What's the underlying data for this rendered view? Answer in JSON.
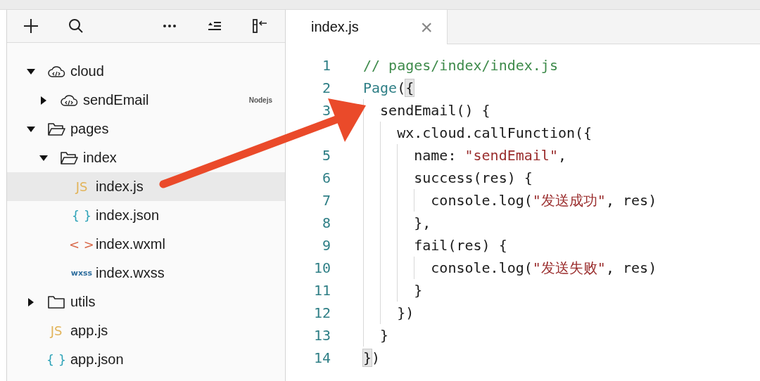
{
  "toolbar": {
    "buttons": [
      {
        "kind": "add"
      },
      {
        "kind": "search"
      },
      {
        "kind": "more"
      },
      {
        "kind": "collapse"
      },
      {
        "kind": "dock"
      }
    ]
  },
  "tree": [
    {
      "label": "cloud",
      "kind": "cloud",
      "expanded": true,
      "selected": false,
      "children": [
        {
          "label": "sendEmail",
          "kind": "cloud",
          "expanded": false,
          "selected": false,
          "tag": "Nodejs"
        }
      ]
    },
    {
      "label": "pages",
      "kind": "folder",
      "expanded": true,
      "selected": false,
      "children": [
        {
          "label": "index",
          "kind": "folder",
          "expanded": true,
          "selected": false,
          "children": [
            {
              "label": "index.js",
              "kind": "file",
              "badge": "JS",
              "color": "#e2b45a",
              "selected": true
            },
            {
              "label": "index.json",
              "kind": "file",
              "badge": "{ }",
              "color": "#2ea3b8",
              "selected": false
            },
            {
              "label": "index.wxml",
              "kind": "file",
              "badge": "< >",
              "color": "#d9694a",
              "selected": false
            },
            {
              "label": "index.wxss",
              "kind": "file",
              "badge": "wxss",
              "color": "#2f6f9f",
              "selected": false
            }
          ]
        }
      ]
    },
    {
      "label": "utils",
      "kind": "folder",
      "expanded": false,
      "selected": false
    },
    {
      "label": "app.js",
      "kind": "file",
      "badge": "JS",
      "color": "#e2b45a",
      "selected": false
    },
    {
      "label": "app.json",
      "kind": "file",
      "badge": "{ }",
      "color": "#2ea3b8",
      "selected": false
    }
  ],
  "editor": {
    "tab": {
      "label": "index.js",
      "close": "×",
      "selected": true
    },
    "lines": [
      {
        "number": "1",
        "tokens": [
          {
            "kind": "comment",
            "text": "// pages/index/index.js"
          }
        ]
      },
      {
        "number": "2",
        "tokens": [
          {
            "kind": "type",
            "text": "Page"
          },
          {
            "kind": "plain",
            "text": "("
          },
          {
            "kind": "bracket",
            "text": "{"
          }
        ]
      },
      {
        "number": "3",
        "tokens": [
          {
            "kind": "plain",
            "text": "  sendEmail() {"
          }
        ]
      },
      {
        "tokens": [
          {
            "kind": "plain",
            "text": "    wx.cloud.callFunction({"
          }
        ]
      },
      {
        "number": "5",
        "tokens": [
          {
            "kind": "plain",
            "text": "      name: "
          },
          {
            "kind": "string",
            "text": "\"sendEmail\""
          },
          {
            "kind": "plain",
            "text": ","
          }
        ]
      },
      {
        "number": "6",
        "tokens": [
          {
            "kind": "plain",
            "text": "      success(res) {"
          }
        ]
      },
      {
        "number": "7",
        "tokens": [
          {
            "kind": "plain",
            "text": "        console.log("
          },
          {
            "kind": "string",
            "text": "\"发送成功\""
          },
          {
            "kind": "plain",
            "text": ", res)"
          }
        ]
      },
      {
        "number": "8",
        "tokens": [
          {
            "kind": "plain",
            "text": "      },"
          }
        ]
      },
      {
        "number": "9",
        "tokens": [
          {
            "kind": "plain",
            "text": "      fail(res) {"
          }
        ]
      },
      {
        "number": "10",
        "tokens": [
          {
            "kind": "plain",
            "text": "        console.log("
          },
          {
            "kind": "string",
            "text": "\"发送失败\""
          },
          {
            "kind": "plain",
            "text": ", res)"
          }
        ]
      },
      {
        "number": "11",
        "tokens": [
          {
            "kind": "plain",
            "text": "      }"
          }
        ]
      },
      {
        "number": "12",
        "tokens": [
          {
            "kind": "plain",
            "text": "    })"
          }
        ]
      },
      {
        "number": "13",
        "tokens": [
          {
            "kind": "plain",
            "text": "  }"
          }
        ]
      },
      {
        "number": "14",
        "tokens": [
          {
            "kind": "bracket",
            "text": "}"
          },
          {
            "kind": "plain",
            "text": ")"
          }
        ]
      }
    ]
  }
}
